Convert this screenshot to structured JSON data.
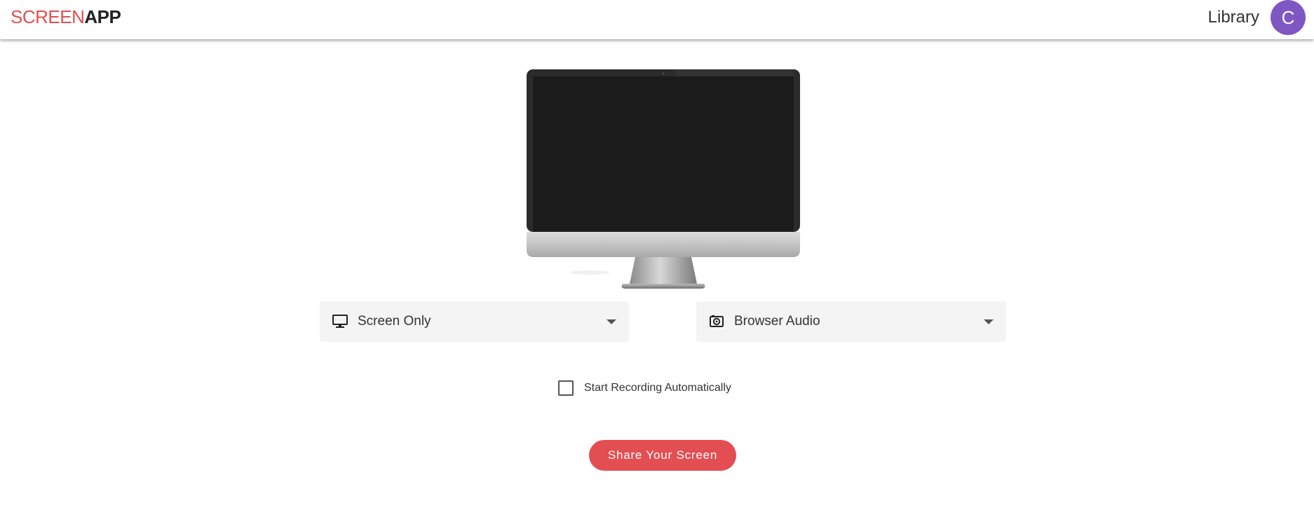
{
  "header": {
    "logo_part1": "SCREEN",
    "logo_part2": "APP",
    "library_label": "Library",
    "avatar_initial": "C"
  },
  "capture": {
    "video_source": {
      "icon": "monitor-icon",
      "value": "Screen Only"
    },
    "audio_source": {
      "icon": "speaker-icon",
      "value": "Browser Audio"
    }
  },
  "options": {
    "auto_start_label": "Start Recording Automatically",
    "auto_start_checked": false
  },
  "cta": {
    "share_label": "Share Your Screen"
  },
  "colors": {
    "brand_red": "#e04f4f",
    "button_red": "#e34e52",
    "avatar_purple": "#7e57c2",
    "select_bg": "#f4f4f4"
  }
}
